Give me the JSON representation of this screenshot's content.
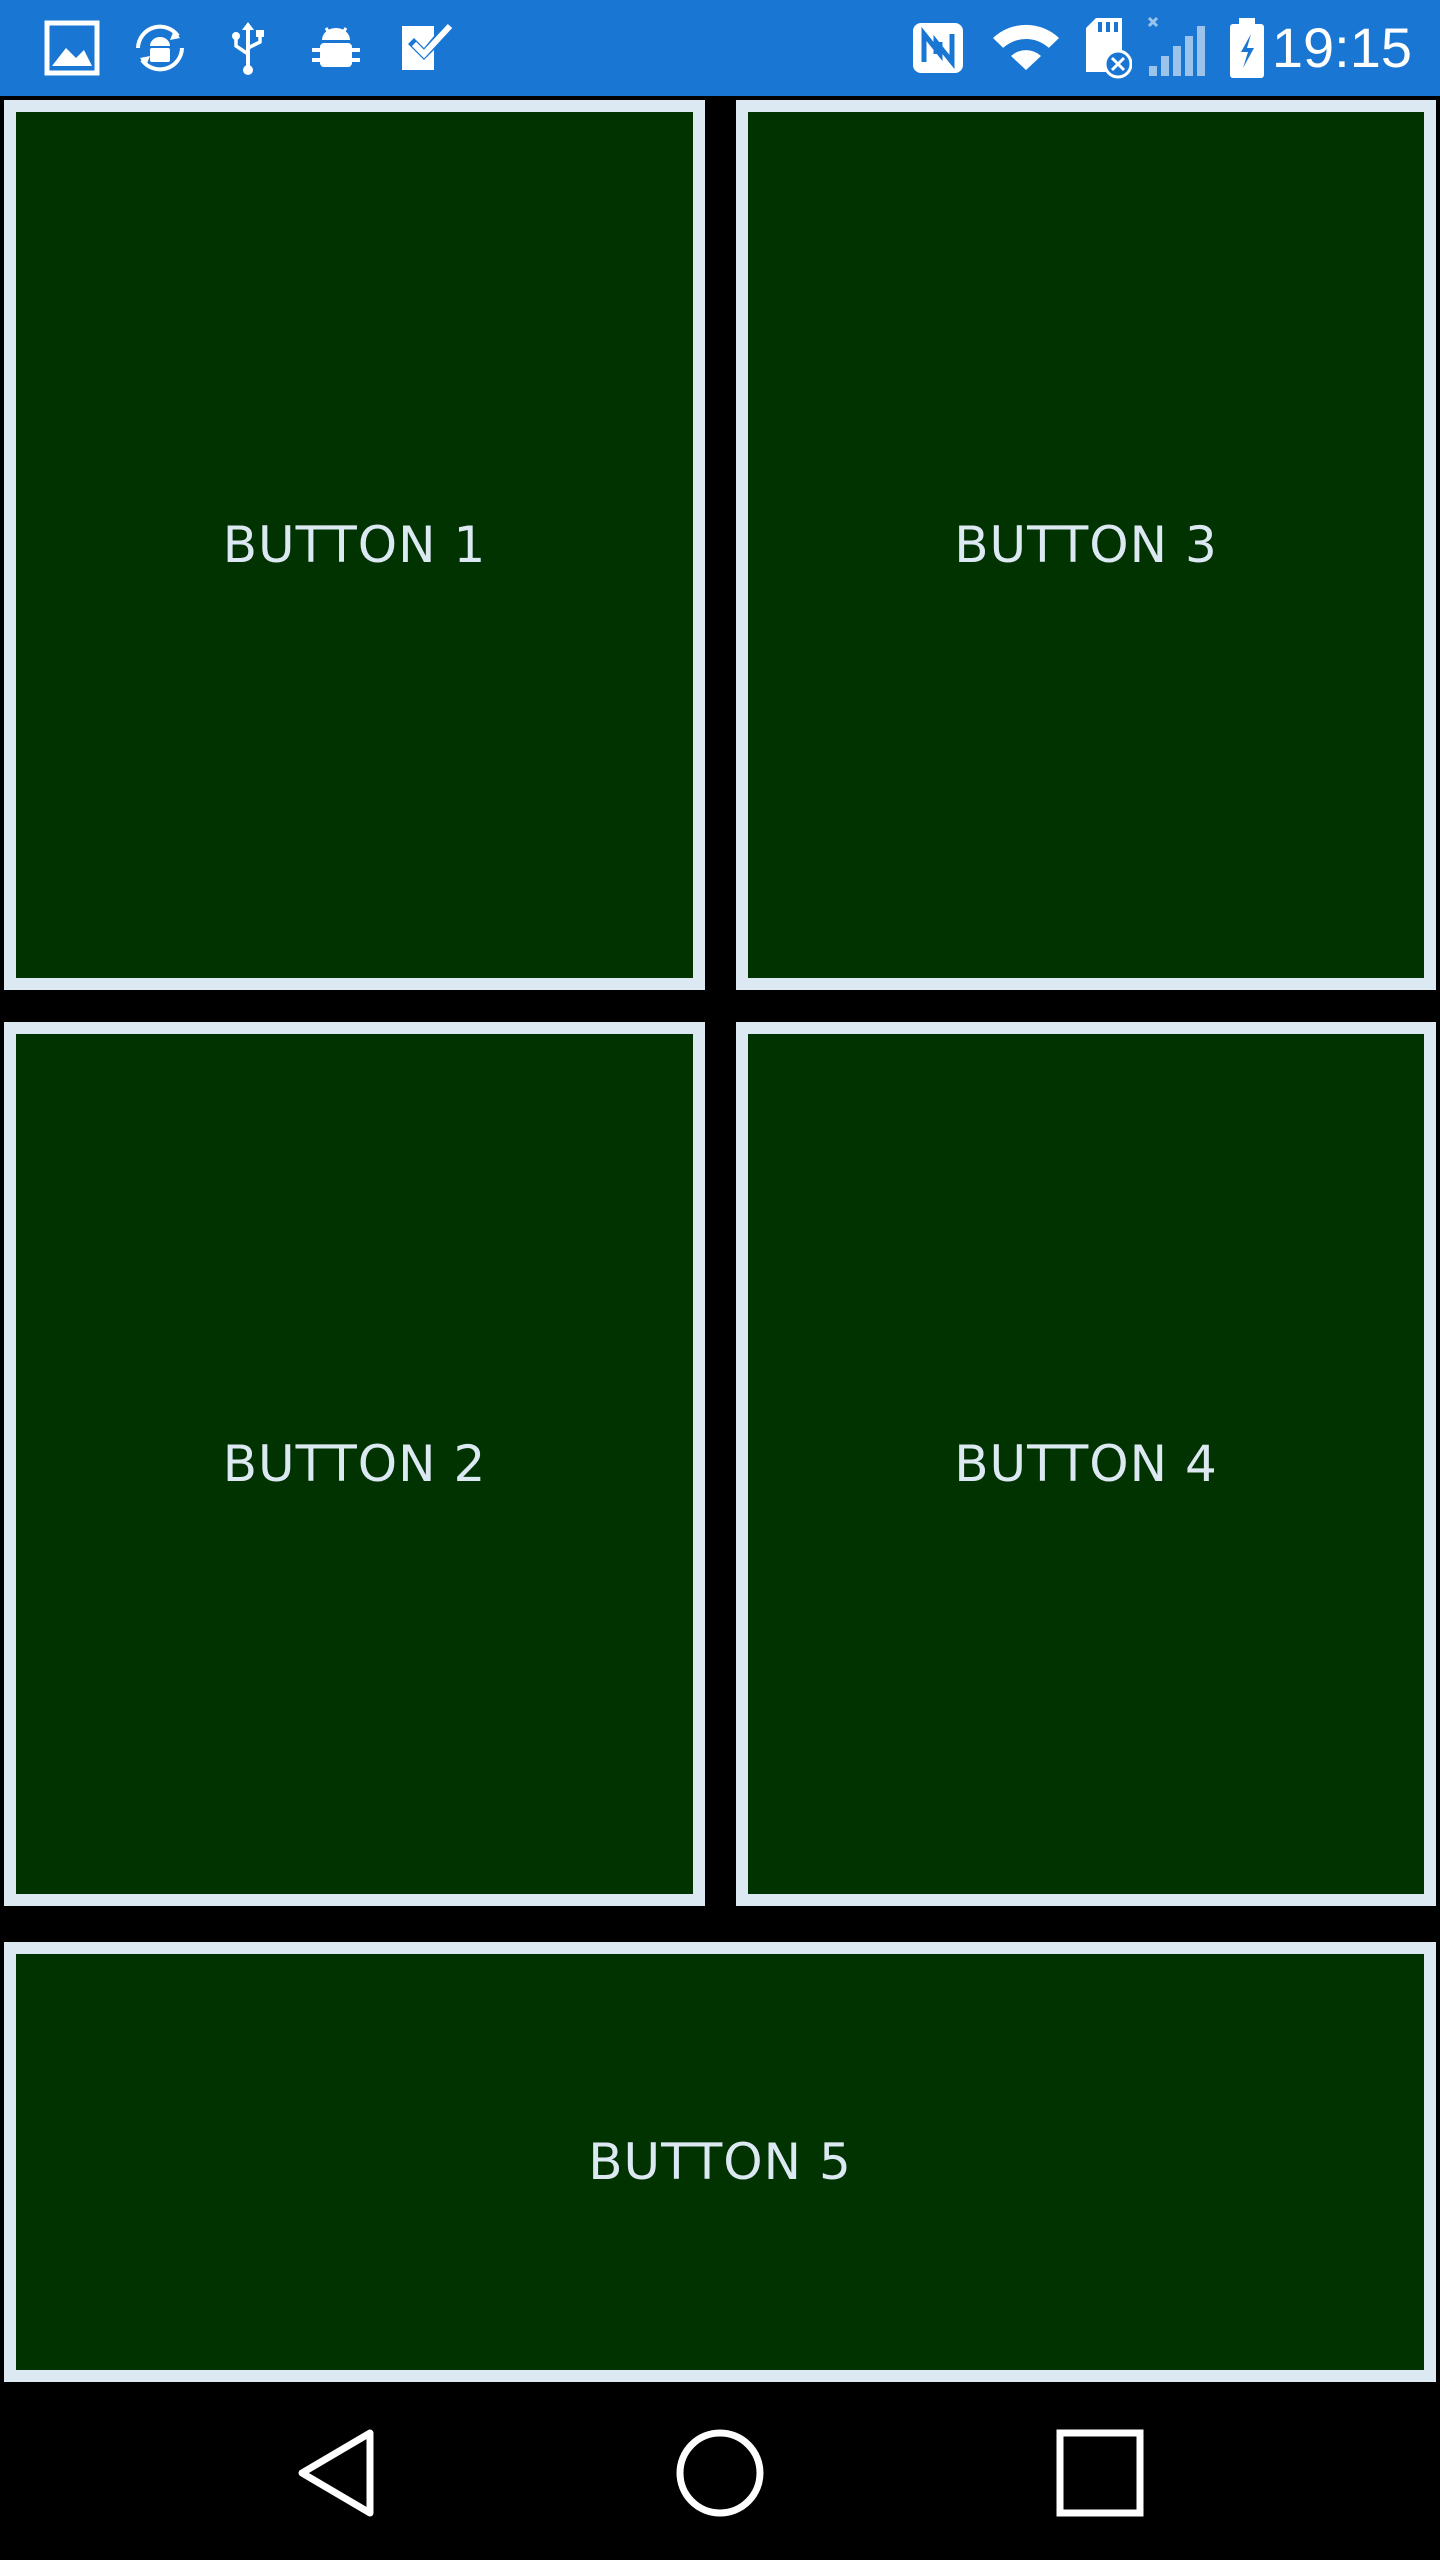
{
  "status_bar": {
    "background": "#1976d2",
    "time": "19:15",
    "left_icons": [
      "gallery-icon",
      "android-sync-icon",
      "usb-icon",
      "debug-bug-icon",
      "task-check-icon"
    ],
    "right_icons": [
      "nfc-icon",
      "wifi-icon",
      "sd-card-error-icon",
      "signal-no-service-icon",
      "battery-charging-icon"
    ]
  },
  "buttons": {
    "button_1": "BUTTON 1",
    "button_2": "BUTTON 2",
    "button_3": "BUTTON 3",
    "button_4": "BUTTON 4",
    "button_5": "BUTTON 5"
  },
  "colors": {
    "button_fill": "#003300",
    "button_border": "#dce9f2",
    "button_text": "#dce9f2",
    "background": "#000000"
  },
  "nav_bar": {
    "items": [
      "back-icon",
      "home-icon",
      "recents-icon"
    ]
  }
}
